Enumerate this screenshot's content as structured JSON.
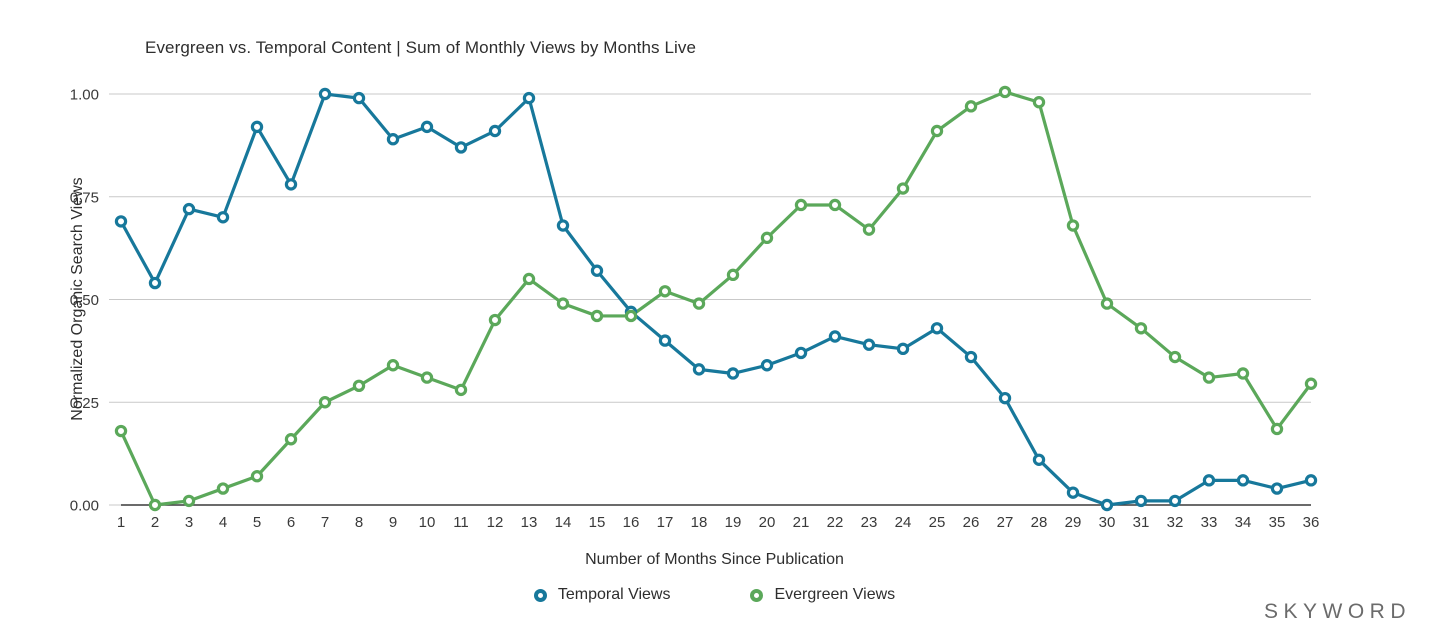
{
  "chart_data": {
    "type": "line",
    "title": "Evergreen vs. Temporal Content | Sum of Monthly Views by Months Live",
    "xlabel": "Number of Months Since Publication",
    "ylabel": "Normalized Organic Search Views",
    "x": [
      1,
      2,
      3,
      4,
      5,
      6,
      7,
      8,
      9,
      10,
      11,
      12,
      13,
      14,
      15,
      16,
      17,
      18,
      19,
      20,
      21,
      22,
      23,
      24,
      25,
      26,
      27,
      28,
      29,
      30,
      31,
      32,
      33,
      34,
      35,
      36
    ],
    "categories": [
      "1",
      "2",
      "3",
      "4",
      "5",
      "6",
      "7",
      "8",
      "9",
      "10",
      "11",
      "12",
      "13",
      "14",
      "15",
      "16",
      "17",
      "18",
      "19",
      "20",
      "21",
      "22",
      "23",
      "24",
      "25",
      "26",
      "27",
      "28",
      "29",
      "30",
      "31",
      "32",
      "33",
      "34",
      "35",
      "36"
    ],
    "xlim": [
      1,
      36
    ],
    "ylim": [
      0,
      1.0
    ],
    "yticks": [
      0,
      0.25,
      0.5,
      0.75,
      1.0
    ],
    "ytick_labels": [
      "0.00",
      "0.25",
      "0.50",
      "0.75",
      "1.00"
    ],
    "grid": true,
    "legend_position": "bottom",
    "series": [
      {
        "name": "Temporal Views",
        "color": "#17789b",
        "values": [
          0.69,
          0.54,
          0.72,
          0.7,
          0.92,
          0.78,
          1.0,
          0.99,
          0.89,
          0.92,
          0.87,
          0.91,
          0.99,
          0.68,
          0.57,
          0.47,
          0.4,
          0.33,
          0.32,
          0.34,
          0.37,
          0.41,
          0.39,
          0.38,
          0.43,
          0.36,
          0.26,
          0.11,
          0.03,
          0.0,
          0.01,
          0.01,
          0.06,
          0.06,
          0.04,
          0.06
        ]
      },
      {
        "name": "Evergreen Views",
        "color": "#5ba85a",
        "values": [
          0.18,
          0.0,
          0.01,
          0.04,
          0.07,
          0.16,
          0.25,
          0.29,
          0.34,
          0.31,
          0.28,
          0.45,
          0.55,
          0.49,
          0.46,
          0.46,
          0.52,
          0.49,
          0.56,
          0.65,
          0.73,
          0.73,
          0.67,
          0.77,
          0.91,
          0.97,
          1.005,
          0.98,
          0.68,
          0.49,
          0.43,
          0.36,
          0.31,
          0.32,
          0.185,
          0.295
        ]
      }
    ]
  },
  "legend": {
    "entries": [
      {
        "label": "Temporal Views",
        "color": "#17789b"
      },
      {
        "label": "Evergreen Views",
        "color": "#5ba85a"
      }
    ]
  },
  "brand": {
    "name": "SKYWORD"
  },
  "colors": {
    "temporal": "#17789b",
    "evergreen": "#5ba85a",
    "grid": "#c9c9c9",
    "axis": "#3a3a3a",
    "background": "#ffffff"
  }
}
